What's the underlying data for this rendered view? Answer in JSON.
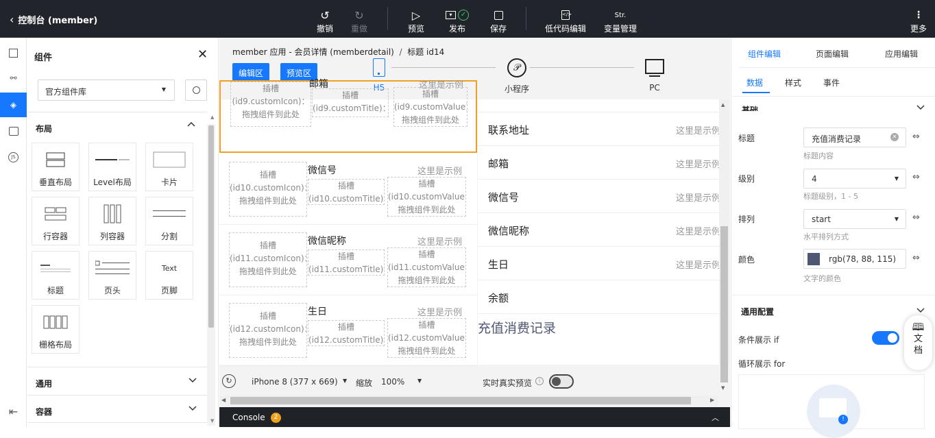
{
  "topbar": {
    "back": "控制台 (member)",
    "undo": "撤销",
    "redo": "重做",
    "preview": "预览",
    "publish": "发布",
    "save": "保存",
    "lowcode": "低代码编辑",
    "vars": "变量管理",
    "vars_icon_text": "Str.",
    "more": "更多"
  },
  "left": {
    "title": "组件",
    "library": "官方组件库",
    "layout_section": "布局",
    "tiles": [
      "垂直布局",
      "Level布局",
      "卡片",
      "行容器",
      "列容器",
      "分割",
      "标题",
      "页头",
      "页脚",
      "栅格布局"
    ],
    "footer_tile_text": "Text",
    "sections": [
      "通用",
      "容器"
    ]
  },
  "center": {
    "breadcrumb": {
      "app": "member 应用 - 会员详情 (memberdetail)",
      "sep": "/",
      "current": "标题 id14"
    },
    "edit_btn": "编辑区",
    "preview_btn": "预览区",
    "devices": [
      "H5",
      "小程序",
      "PC"
    ],
    "slot_rows": [
      {
        "icon": "插槽\n(id9.customIcon)：拖拽组件到此处",
        "title": "邮箱",
        "titleSlot": "插槽(id9.customTitle)：拖拽组件到此处",
        "value": "这里是示例",
        "valueSlot": "插槽\n(id9.customValue)：\n拖拽组件到此处"
      },
      {
        "icon": "插槽\n(id10.customIcon)：\n拖拽组件到此处",
        "title": "微信号",
        "titleSlot": "插槽(id10.customTitle)：拖拽组件到此处",
        "value": "这里是示例",
        "valueSlot": "插槽\n(id10.customValue)：\n拖拽组件到此处"
      },
      {
        "icon": "插槽\n(id11.customIcon)：\n拖拽组件到此处",
        "title": "微信昵称",
        "titleSlot": "插槽(id11.customTitle)：拖拽组件到此处",
        "value": "这里是示例",
        "valueSlot": "插槽\n(id11.customValue)：\n拖拽组件到此处"
      },
      {
        "icon": "插槽\n(id12.customIcon)：\n拖拽组件到此处",
        "title": "生日",
        "titleSlot": "插槽(id12.customTitle)：拖拽组件到此处",
        "value": "这里是示例",
        "valueSlot": "插槽\n(id12.customValue)：\n拖拽组件到此处"
      }
    ],
    "preview_rows": [
      {
        "label": "联系地址",
        "value": "这里是示例"
      },
      {
        "label": "邮箱",
        "value": "这里是示例"
      },
      {
        "label": "微信号",
        "value": "这里是示例"
      },
      {
        "label": "微信昵称",
        "value": "这里是示例"
      },
      {
        "label": "生日",
        "value": "这里是示例"
      },
      {
        "label": "余额",
        "value": ""
      }
    ],
    "heading": "充值消费记录",
    "device_select": "iPhone 8 (377 x 669)",
    "zoom_label": "缩放",
    "zoom": "100%",
    "realtime": "实时真实预览",
    "console": "Console",
    "console_count": "2"
  },
  "right": {
    "tabs": [
      "组件编辑",
      "页面编辑",
      "应用编辑"
    ],
    "subtabs": [
      "数据",
      "样式",
      "事件"
    ],
    "basic": "基础",
    "title_label": "标题",
    "title_value": "充值消费记录",
    "title_hint": "标题内容",
    "level_label": "级别",
    "level_value": "4",
    "level_hint": "标题级别，1 - 5",
    "align_label": "排列",
    "align_value": "start",
    "align_hint": "水平排列方式",
    "color_label": "颜色",
    "color_value": "rgb(78, 88, 115)",
    "color_swatch": "#4e5873",
    "color_hint": "文字的颜色",
    "general": "通用配置",
    "cond": "条件展示 if",
    "loop": "循环展示 for",
    "doc": "文\n档"
  },
  "colors": {
    "accent": "#1677ff",
    "topbar": "#21252b",
    "selected_border": "#f0a020"
  }
}
